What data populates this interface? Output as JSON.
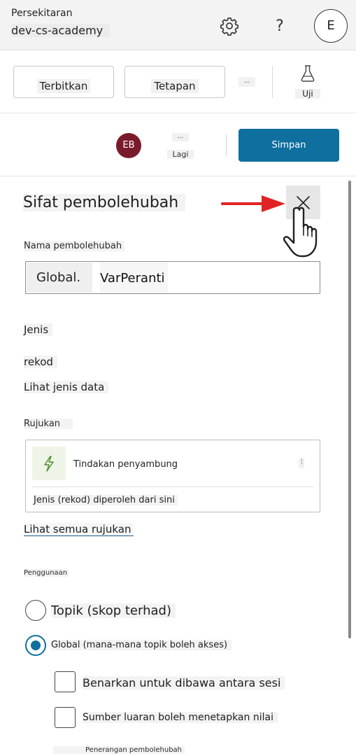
{
  "header": {
    "environment_label": "Persekitaran",
    "environment_name": "dev-cs-academy",
    "help_label": "?",
    "user_initial": "E"
  },
  "commandbar": {
    "publish_label": "Terbitkan",
    "settings_label": "Tetapan",
    "more_label": "...",
    "test_label": "Uji"
  },
  "userbar": {
    "avatar_initials": "EB",
    "more_dots": "...",
    "more_label": "Lagi",
    "save_label": "Simpan"
  },
  "panel": {
    "title": "Sifat pembolehubah",
    "variable_name_label": "Nama pembolehubah",
    "variable_prefix": "Global.",
    "variable_name": "VarPeranti",
    "type_heading": "Jenis",
    "type_value": "rekod",
    "view_data_type_link": "Lihat jenis data",
    "references_heading": "Rujukan",
    "reference_card": {
      "title": "Tindakan penyambung",
      "kebab": "⋮",
      "description": "Jenis (rekod) diperoleh dari sini"
    },
    "view_all_references_link": "Lihat semua rujukan",
    "usage_heading": "Penggunaan",
    "scope_options": [
      {
        "label": "Topik (skop terhad)",
        "selected": false
      },
      {
        "label": "Global (mana-mana topik boleh akses)",
        "selected": true
      }
    ],
    "checkbox_options": [
      {
        "label": "Benarkan untuk dibawa antara sesi",
        "checked": false
      },
      {
        "label": "Sumber luaran boleh menetapkan nilai",
        "checked": false
      }
    ],
    "description_label": "Penerangan pembolehubah"
  },
  "colors": {
    "accent": "#0f6f9e",
    "avatar_bg": "#7a1b2b",
    "arrow": "#e02424"
  }
}
